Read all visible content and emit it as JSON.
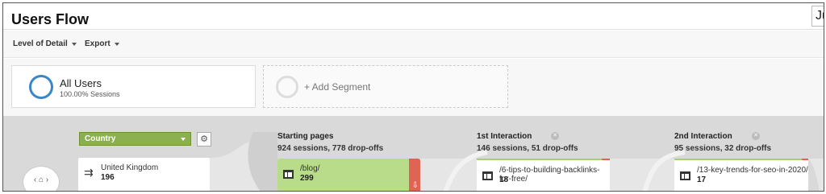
{
  "header": {
    "title": "Users Flow",
    "date_fragment": "Ju"
  },
  "toolbar": {
    "level_of_detail": "Level of Detail",
    "export": "Export"
  },
  "segments": {
    "active": {
      "name": "All Users",
      "sessions": "100.00% Sessions"
    },
    "add_label": "+ Add Segment"
  },
  "flow": {
    "dimension": "Country",
    "columns": [
      {
        "title": "Starting pages",
        "stats": "924 sessions, 778 drop-offs"
      },
      {
        "title": "1st Interaction",
        "stats": "146 sessions, 51 drop-offs"
      },
      {
        "title": "2nd Interaction",
        "stats": "95 sessions, 32 drop-offs"
      }
    ],
    "nodes": {
      "country": {
        "label": "United Kingdom",
        "count": "196"
      },
      "start": {
        "label": "/blog/",
        "count": "299"
      },
      "i1": {
        "label": "/6-tips-to-building-backlinks-for-free/",
        "count": "18"
      },
      "i2": {
        "label": "/13-key-trends-for-seo-in-2020/",
        "count": "17"
      }
    }
  },
  "colors": {
    "accent_blue": "#3a87c8",
    "country_green": "#8cb050",
    "node_green": "#b8dc8a",
    "dropoff_red": "#e06454"
  },
  "icons": [
    "caret-down-icon",
    "gear-icon",
    "close-circle-icon",
    "page-icon",
    "redirect-arrow-icon",
    "home-icon",
    "chevron-left-icon",
    "chevron-right-icon"
  ]
}
